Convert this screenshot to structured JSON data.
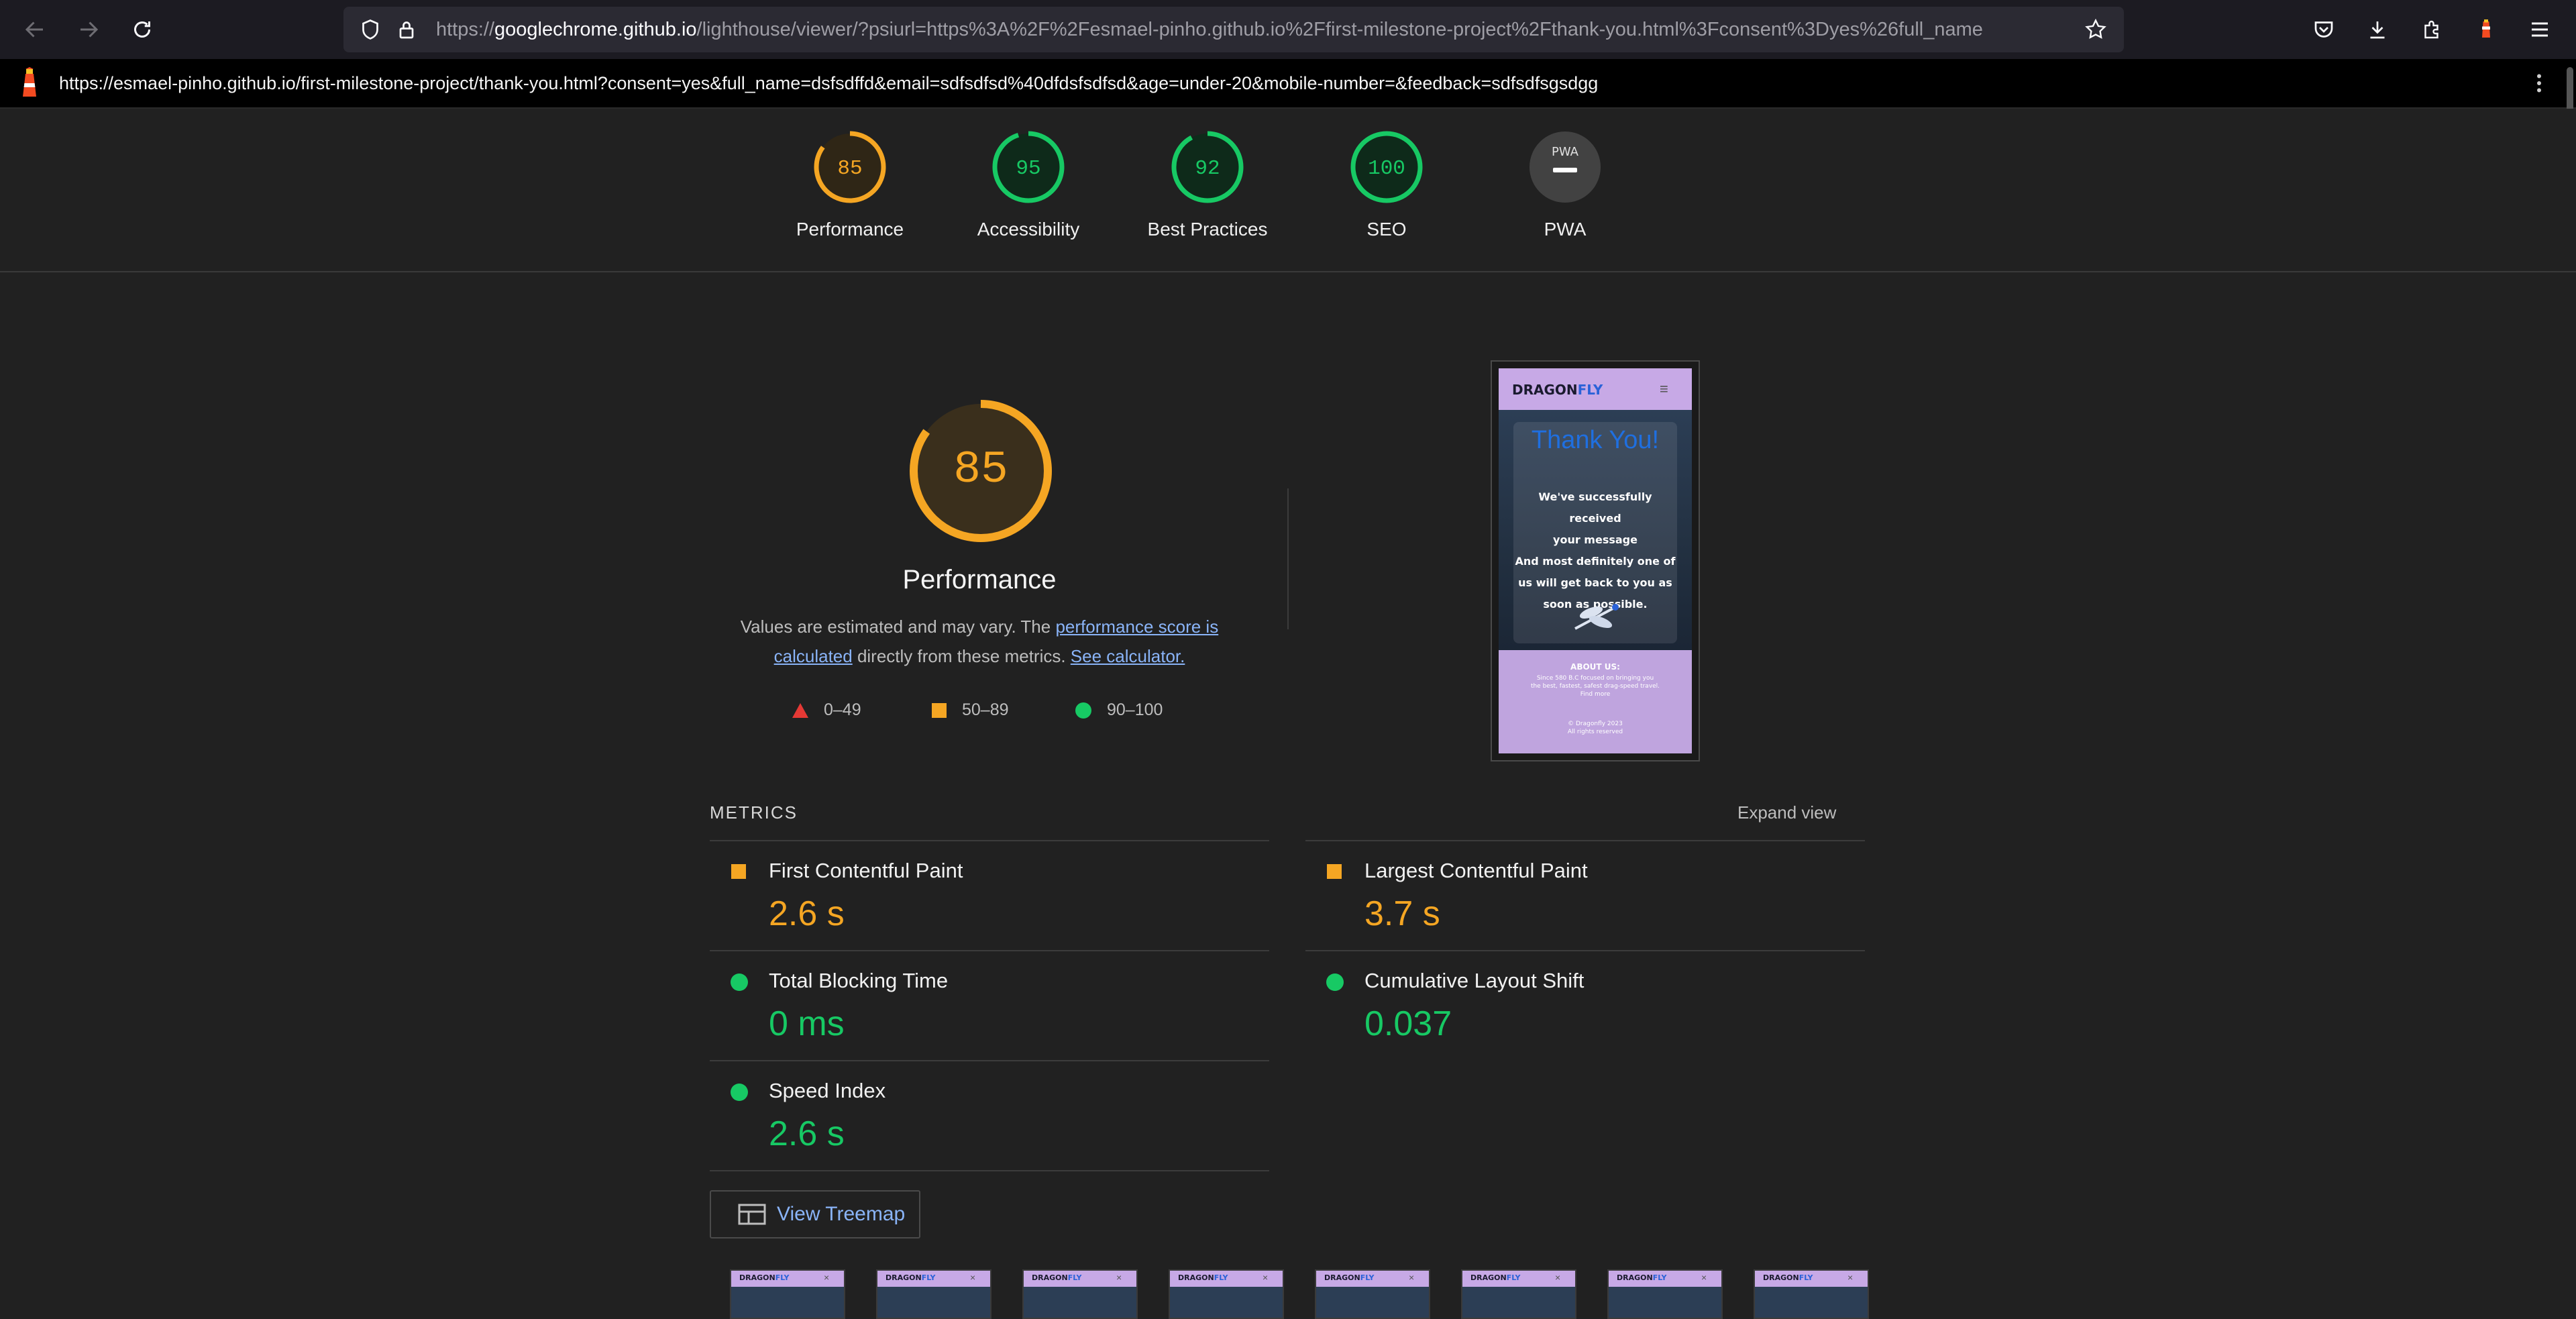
{
  "browser": {
    "url_host": "googlechrome.github.io",
    "url_prefix": "https://",
    "url_rest": "/lighthouse/viewer/?psiurl=https%3A%2F%2Fesmael-pinho.github.io%2Ffirst-milestone-project%2Fthank-you.html%3Fconsent%3Dyes%26full_name"
  },
  "report": {
    "tested_url": "https://esmael-pinho.github.io/first-milestone-project/thank-you.html?consent=yes&full_name=dsfsdffd&email=sdfsdfsd%40dfdsfsdfsd&age=under-20&mobile-number=&feedback=sdfsdfsgsdgg"
  },
  "categories": [
    {
      "label": "Performance",
      "score": "85",
      "fraction": 0.85,
      "color": "#f5a623"
    },
    {
      "label": "Accessibility",
      "score": "95",
      "fraction": 0.95,
      "color": "#17c964"
    },
    {
      "label": "Best Practices",
      "score": "92",
      "fraction": 0.92,
      "color": "#17c964"
    },
    {
      "label": "SEO",
      "score": "100",
      "fraction": 1.0,
      "color": "#17c964"
    },
    {
      "label": "PWA",
      "badge": "PWA",
      "score": "",
      "fraction": 0,
      "color": "#9e9e9e"
    }
  ],
  "performance": {
    "score": "85",
    "fraction": 0.85,
    "title": "Performance",
    "desc_pre": "Values are estimated and may vary. The ",
    "desc_link1": "performance score is calculated",
    "desc_mid": " directly from these metrics. ",
    "desc_link2": "See calculator.",
    "legend": [
      {
        "range": "0–49",
        "shape": "triangle",
        "color": "#e53935"
      },
      {
        "range": "50–89",
        "shape": "square",
        "color": "#f5a623"
      },
      {
        "range": "90–100",
        "shape": "circle",
        "color": "#17c964"
      }
    ]
  },
  "screenshot": {
    "brand_a": "DRAGON",
    "brand_b": "FLY",
    "heading": "Thank You!",
    "message_lines": [
      "We've successfully received",
      "your message",
      "And most definitely one of",
      "us will get back to you as",
      "soon as possible."
    ],
    "about_title": "ABOUT US:",
    "about_lines": [
      "Since 580 B.C focused on bringing you",
      "the best, fastest, safest drag-speed travel.",
      "Find more"
    ],
    "copyright_lines": [
      "© Dragonfly 2023",
      "All rights reserved"
    ]
  },
  "metrics": {
    "title": "METRICS",
    "expand": "Expand view",
    "items": [
      {
        "name": "First Contentful Paint",
        "value": "2.6 s",
        "status": "average"
      },
      {
        "name": "Largest Contentful Paint",
        "value": "3.7 s",
        "status": "average"
      },
      {
        "name": "Total Blocking Time",
        "value": "0 ms",
        "status": "pass"
      },
      {
        "name": "Cumulative Layout Shift",
        "value": "0.037",
        "status": "pass"
      },
      {
        "name": "Speed Index",
        "value": "2.6 s",
        "status": "pass"
      }
    ]
  },
  "treemap": {
    "label": "View Treemap"
  },
  "filmstrip": {
    "brand_a": "DRAGON",
    "brand_b": "FLY",
    "count": 8
  }
}
